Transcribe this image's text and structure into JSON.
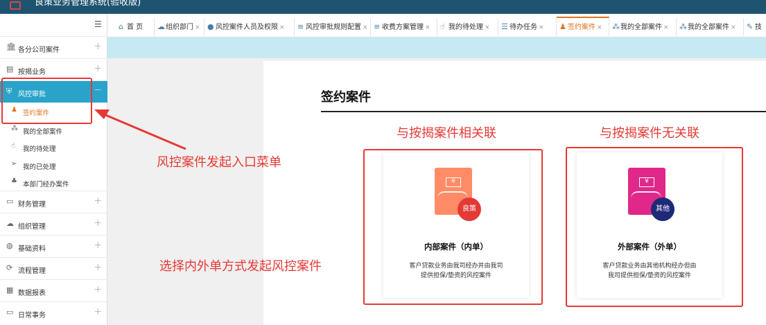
{
  "app": {
    "title": "良策业务管理系统(验收版)"
  },
  "tabs": [
    {
      "label": "首 页",
      "icon": "home-icon",
      "glyph": "⌂",
      "closable": false
    },
    {
      "label": "组织部门",
      "icon": "cloud-icon",
      "glyph": "☁",
      "closable": true
    },
    {
      "label": "风控案件人员及权限",
      "icon": "user-icon",
      "glyph": "●",
      "closable": true
    },
    {
      "label": "风控审批规则配置",
      "icon": "list-icon",
      "glyph": "≡",
      "closable": true
    },
    {
      "label": "收费方案管理",
      "icon": "list-icon",
      "glyph": "≡",
      "closable": true
    },
    {
      "label": "我的待处理",
      "icon": "thumb-icon",
      "glyph": "☝",
      "closable": true
    },
    {
      "label": "待办任务",
      "icon": "task-icon",
      "glyph": "☰",
      "closable": true
    },
    {
      "label": "签约案件",
      "icon": "sign-user-icon",
      "glyph": "♟",
      "closable": true,
      "active": true
    },
    {
      "label": "我的全部案件",
      "icon": "grid-icon",
      "glyph": "⁂",
      "closable": true
    },
    {
      "label": "我的全部案件",
      "icon": "grid-icon",
      "glyph": "⁂",
      "closable": true
    },
    {
      "label": "技",
      "icon": "edit-icon",
      "glyph": "✎",
      "closable": false
    }
  ],
  "sidebar": {
    "items": [
      {
        "label": "各分公司案件",
        "icon": "bank-icon",
        "glyph": "🏛"
      },
      {
        "label": "按揭业务",
        "icon": "document-icon",
        "glyph": "▤"
      },
      {
        "label": "风控审批",
        "icon": "shield-icon",
        "glyph": "⛨",
        "active": true,
        "expanded": true
      },
      {
        "label": "财务管理",
        "icon": "wallet-icon",
        "glyph": "▭"
      },
      {
        "label": "组织管理",
        "icon": "cloud-icon",
        "glyph": "☁"
      },
      {
        "label": "基础资料",
        "icon": "data-icon",
        "glyph": "◍"
      },
      {
        "label": "流程管理",
        "icon": "flow-icon",
        "glyph": "⟳"
      },
      {
        "label": "数据报表",
        "icon": "table-icon",
        "glyph": "▦"
      },
      {
        "label": "日常事务",
        "icon": "monitor-icon",
        "glyph": "▭"
      }
    ],
    "subitems": [
      {
        "label": "签约案件",
        "icon": "sign-user-icon",
        "glyph": "♟",
        "current": true
      },
      {
        "label": "我的全部案件",
        "icon": "grid-icon",
        "glyph": "⁂"
      },
      {
        "label": "我的待处理",
        "icon": "thumb-icon",
        "glyph": "☝"
      },
      {
        "label": "我的已处理",
        "icon": "send-icon",
        "glyph": "➢"
      },
      {
        "label": "本部门经办案件",
        "icon": "org-icon",
        "glyph": "♣"
      }
    ]
  },
  "main": {
    "title": "签约案件",
    "groups": [
      {
        "label": "与按揭案件相关联"
      },
      {
        "label": "与按揭案件无关联"
      }
    ],
    "cards": [
      {
        "name": "内部案件（内单）",
        "badge": "良策",
        "desc_line1": "客户贷款业务由我司经办并由我司",
        "desc_line2": "提供担保/垫资的风控案件",
        "doc_color": "#ff8c66",
        "badge_color": "#e53935"
      },
      {
        "name": "外部案件（外单）",
        "badge": "其他",
        "desc_line1": "客户贷款业务由其他机构经办但由",
        "desc_line2": "我司提供担保/垫资的风控案件",
        "doc_color": "#e0288a",
        "badge_color": "#1e2a78"
      }
    ]
  },
  "annotations": {
    "menu_entry": "风控案件发起入口菜单",
    "select_mode": "选择内外单方式发起风控案件"
  },
  "colors": {
    "accent": "#29a3c9",
    "active_tab": "#e0721e",
    "annotation": "#e53935",
    "topbar": "#1e5470"
  }
}
